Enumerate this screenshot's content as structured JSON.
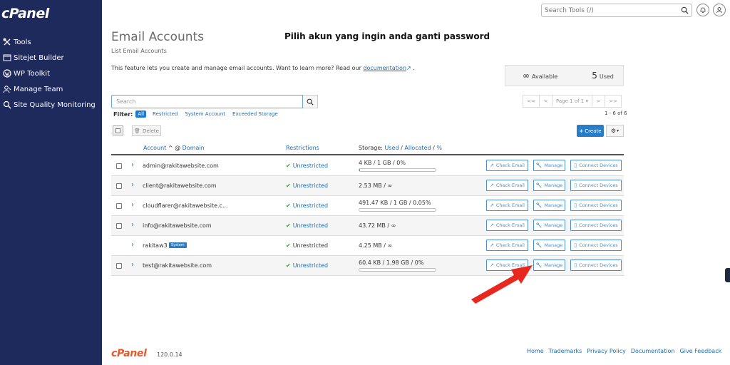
{
  "app": {
    "logo": "cPanel",
    "version": "120.0.14"
  },
  "sidebar": {
    "items": [
      {
        "label": "Tools",
        "icon": "tools-icon"
      },
      {
        "label": "Sitejet Builder",
        "icon": "sitejet-icon"
      },
      {
        "label": "WP Toolkit",
        "icon": "wordpress-icon"
      },
      {
        "label": "Manage Team",
        "icon": "team-icon"
      },
      {
        "label": "Site Quality Monitoring",
        "icon": "quality-search-icon"
      }
    ]
  },
  "topbar": {
    "search_placeholder": "Search Tools (/)"
  },
  "page": {
    "title": "Email Accounts",
    "breadcrumb": "List Email Accounts",
    "annotation": "Pilih akun yang ingin anda ganti password",
    "intro_text": "This feature lets you create and manage email accounts. Want to learn more? Read our",
    "intro_link": "documentation",
    "intro_end": "."
  },
  "stats": {
    "available_symbol": "∞",
    "available_label": "Available",
    "used_count": "5",
    "used_label": "Used"
  },
  "search": {
    "placeholder": "Search"
  },
  "filter": {
    "label": "Filter:",
    "options": [
      "All",
      "Restricted",
      "System Account",
      "Exceeded Storage"
    ]
  },
  "pager": {
    "first": "<<",
    "prev": "<",
    "page": "Page 1 of 1",
    "next": ">",
    "last": ">>",
    "range": "1 - 6 of 6"
  },
  "toolbar": {
    "delete_label": "Delete",
    "create_label": "Create"
  },
  "table": {
    "headers": {
      "account": "Account",
      "domain": "Domain",
      "at": "@",
      "restrictions": "Restrictions",
      "storage": "Storage:",
      "used": "Used",
      "allocated": "Allocated",
      "percent": "%"
    },
    "rows": [
      {
        "account": "admin@rakitawebsite.com",
        "restriction": "Unrestricted",
        "storage": "4 KB / 1 GB / 0%",
        "usage": 0.004
      },
      {
        "account": "client@rakitawebsite.com",
        "restriction": "Unrestricted",
        "storage": "2.53 MB / ∞"
      },
      {
        "account": "cloudflarer@rakitawebsite.c...",
        "restriction": "Unrestricted",
        "storage": "491.47 KB / 1 GB / 0.05%",
        "usage": 0.0005
      },
      {
        "account": "info@rakitawebsite.com",
        "restriction": "Unrestricted",
        "storage": "43.72 MB / ∞"
      },
      {
        "account": "rakitaw3",
        "badge": "System",
        "restriction": "Unrestricted",
        "storage": "4.25 MB / ∞"
      },
      {
        "account": "test@rakitawebsite.com",
        "restriction": "Unrestricted",
        "storage": "60.4 KB / 1.98 GB / 0%",
        "usage": 0.0
      }
    ],
    "actions": {
      "check": "Check Email",
      "manage": "Manage",
      "connect": "Connect Devices"
    }
  },
  "footer": {
    "logo": "cPanel",
    "links": [
      "Home",
      "Trademarks",
      "Privacy Policy",
      "Documentation",
      "Give Feedback"
    ]
  },
  "colors": {
    "sidebar": "#1f2a5c",
    "accent": "#2a7cc7",
    "arrow": "#e8281f",
    "brand_orange": "#e8582b"
  }
}
